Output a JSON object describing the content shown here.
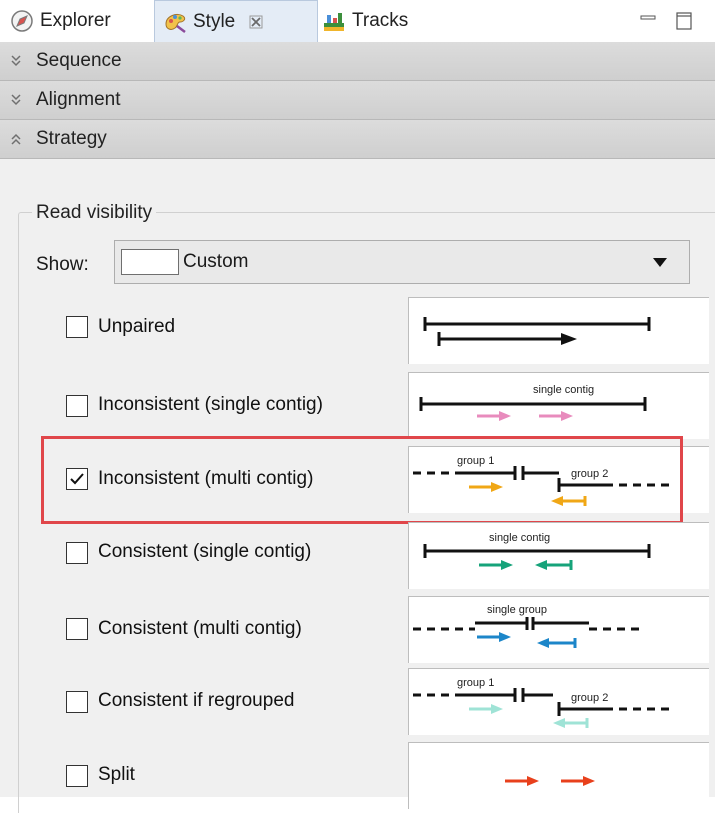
{
  "tabs": [
    {
      "label": "Explorer",
      "icon": "compass-icon"
    },
    {
      "label": "Style",
      "icon": "palette-icon",
      "active": true,
      "closeable": true
    },
    {
      "label": "Tracks",
      "icon": "tracks-icon"
    }
  ],
  "sections": [
    {
      "label": "Sequence",
      "expanded": false
    },
    {
      "label": "Alignment",
      "expanded": false
    },
    {
      "label": "Strategy",
      "expanded": true
    }
  ],
  "read_visibility": {
    "title": "Read visibility",
    "show_label": "Show:",
    "show_value": "Custom",
    "rows": [
      {
        "label": "Unpaired",
        "checked": false
      },
      {
        "label": "Inconsistent (single contig)",
        "checked": false,
        "preview_text": [
          "single contig"
        ]
      },
      {
        "label": "Inconsistent (multi contig)",
        "checked": true,
        "highlighted": true,
        "preview_text": [
          "group 1",
          "group 2"
        ]
      },
      {
        "label": "Consistent (single contig)",
        "checked": false,
        "preview_text": [
          "single contig"
        ]
      },
      {
        "label": "Consistent (multi contig)",
        "checked": false,
        "preview_text": [
          "single group"
        ]
      },
      {
        "label": "Consistent if regrouped",
        "checked": false,
        "preview_text": [
          "group 1",
          "group 2"
        ]
      },
      {
        "label": "Split",
        "checked": false
      }
    ]
  },
  "colors": {
    "highlight": "#e0464a",
    "pink": "#e88bbd",
    "orange": "#f0a716",
    "green": "#16a37a",
    "blue": "#1c86c9",
    "mint": "#9fe3d6",
    "red": "#e8401c"
  }
}
